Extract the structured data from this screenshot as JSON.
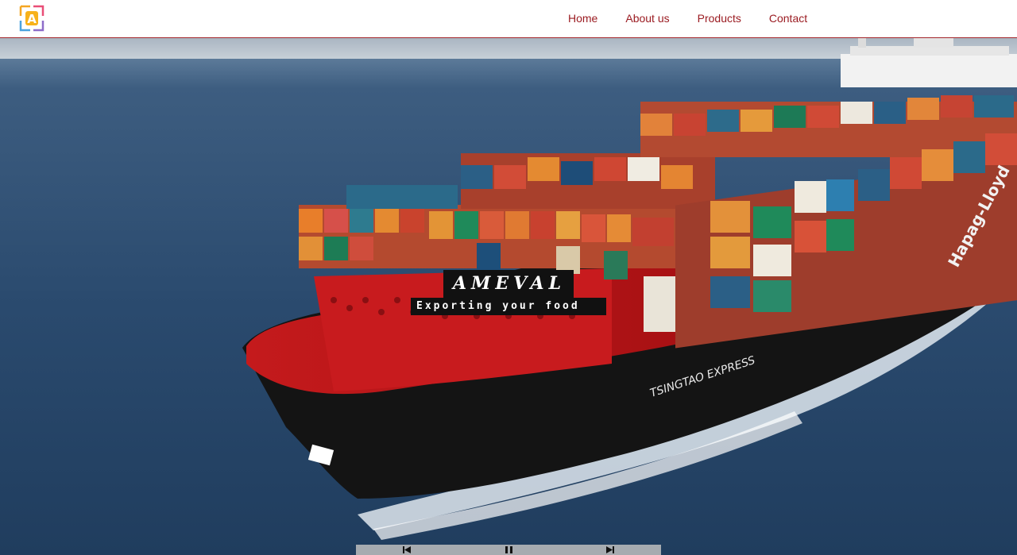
{
  "header": {
    "logo_letter": "A",
    "nav": [
      {
        "label": "Home"
      },
      {
        "label": "About us"
      },
      {
        "label": "Products"
      },
      {
        "label": "Contact"
      }
    ]
  },
  "hero": {
    "brand": "AMEVAL",
    "tagline": "Exporting your food",
    "ship_name": "TSINGTAO EXPRESS",
    "hull_logo": "Hapag-Lloyd"
  },
  "slider_controls": {
    "prev_icon": "skip-previous-icon",
    "pause_icon": "pause-icon",
    "next_icon": "skip-next-icon"
  },
  "colors": {
    "nav_text": "#9b1c22",
    "header_border": "#a3262b",
    "sea": "#2a4a6e",
    "hull": "#141414",
    "deck_red": "#c8191d"
  }
}
